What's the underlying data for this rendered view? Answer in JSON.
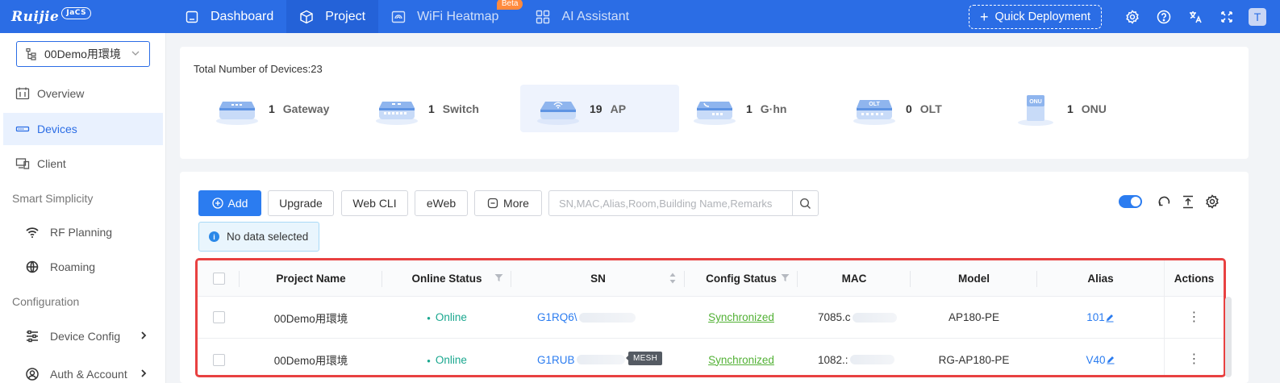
{
  "brand": {
    "name": "Ruijie",
    "badge": "JaCS"
  },
  "nav": {
    "items": [
      {
        "label": "Dashboard",
        "icon": "dashboard-icon"
      },
      {
        "label": "Project",
        "icon": "cube-icon"
      },
      {
        "label": "WiFi Heatmap",
        "icon": "heatmap-icon",
        "badge": "Beta"
      },
      {
        "label": "AI Assistant",
        "icon": "grid-icon"
      }
    ],
    "quick_deploy": "Quick Deployment",
    "avatar": "T"
  },
  "sidebar": {
    "project": "00Demo用環境",
    "overview": "Overview",
    "devices": "Devices",
    "client": "Client",
    "group_smart": "Smart Simplicity",
    "rf_planning": "RF Planning",
    "roaming": "Roaming",
    "group_config": "Configuration",
    "device_config": "Device Config",
    "auth_account": "Auth & Account"
  },
  "summary": {
    "title": "Total Number of Devices:23",
    "types": [
      {
        "count": "1",
        "label": "Gateway"
      },
      {
        "count": "1",
        "label": "Switch"
      },
      {
        "count": "19",
        "label": "AP"
      },
      {
        "count": "1",
        "label": "G·hn"
      },
      {
        "count": "0",
        "label": "OLT"
      },
      {
        "count": "1",
        "label": "ONU"
      }
    ],
    "icon_texts": {
      "olt": "OLT",
      "onu": "ONU"
    }
  },
  "toolbar": {
    "add": "Add",
    "upgrade": "Upgrade",
    "webcli": "Web CLI",
    "eweb": "eWeb",
    "more": "More",
    "search_placeholder": "SN,MAC,Alias,Room,Building Name,Remarks",
    "selection": "No data selected"
  },
  "table": {
    "headers": {
      "project": "Project Name",
      "online": "Online Status",
      "sn": "SN",
      "config": "Config Status",
      "mac": "MAC",
      "model": "Model",
      "alias": "Alias",
      "actions": "Actions"
    },
    "rows": [
      {
        "project": "00Demo用環境",
        "online": "Online",
        "sn": "G1RQ6\\",
        "config": "Synchronized",
        "mac": "7085.c",
        "model": "AP180-PE",
        "alias": "101"
      },
      {
        "project": "00Demo用環境",
        "online": "Online",
        "sn": "G1RUB",
        "sn_tag": "MESH",
        "config": "Synchronized",
        "mac": "1082.:",
        "model": "RG-AP180-PE",
        "alias": "V40"
      }
    ]
  },
  "colors": {
    "primary": "#2b6de5",
    "online": "#1aa78f",
    "synced": "#52b135",
    "highlight": "#e84141"
  }
}
